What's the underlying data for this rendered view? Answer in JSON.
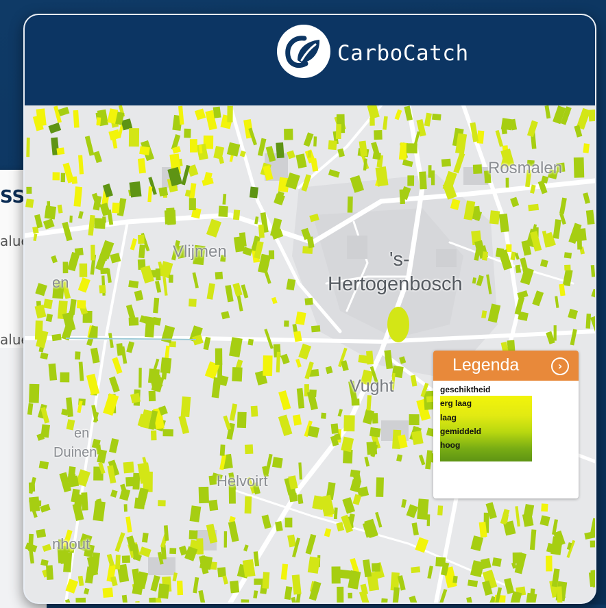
{
  "side_panel": {
    "heading_fragment": "SS",
    "line1_fragment": "alue",
    "line2_fragment": "alue"
  },
  "app": {
    "brand": "CarboCatch",
    "logo_icon": "leaf-icon"
  },
  "map": {
    "places": {
      "rosmalen": "Rosmalen",
      "vlijmen": "Vlijmen",
      "hertogenbosch_1": "'s-",
      "hertogenbosch_2": "Hertogenbosch",
      "vught": "Vught",
      "helvoirt": "Helvoirt",
      "duinen_1": "en",
      "duinen_2": "Duinen",
      "en_left": "en",
      "nhout": "nhout"
    }
  },
  "legend": {
    "title": "Legenda",
    "chevron_icon": "chevron-right-icon",
    "subtitle": "geschiktheid",
    "items": [
      "erg laag",
      "laag",
      "gemiddeld",
      "hoog"
    ],
    "colors": [
      "#f2f40a",
      "#d3e616",
      "#a6ce12",
      "#5e9414"
    ]
  }
}
